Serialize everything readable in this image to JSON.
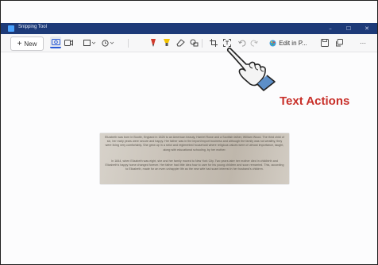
{
  "window": {
    "title": "Snipping Tool",
    "minimize": "–",
    "maximize": "☐",
    "close": "✕"
  },
  "toolbar": {
    "new_label": "New",
    "new_plus": "+",
    "edit_label": "Edit in P...",
    "more_label": "···"
  },
  "callout": {
    "label": "Text Actions"
  },
  "captured_text": {
    "paragraph_1": "Elizabeth was born in Bootle, England in 1826 to an American beauty, Harriet Rowe and a Scottish father, William Wood. The third child of six, her early years were secure and happy. Her father was in the import/export business and although the family was not wealthy, they were living very comfortably. She grew up in a strict and regimented household where religious values were of utmost importance, taught, along with educational schooling, by her mother.",
    "paragraph_2": "In 1844, when Elizabeth was eight, she and her family moved to New York City. Two years later her mother died in childbirth and Elizabeth's happy home changed forever. Her father had little idea how to care for his young children and soon remarried. This, according to Elizabeth, made for an even unhappier life as the new wife had scant interest in her husband's children."
  },
  "colors": {
    "titlebar": "#1d3a78",
    "accent": "#2a5bd7",
    "callout": "#c8302a"
  },
  "icons": [
    "snipping-tool-icon",
    "camera-icon",
    "video-icon",
    "rectangle-snip-icon",
    "timer-icon",
    "ballpoint-pen-icon",
    "highlighter-icon",
    "eraser-icon",
    "shapes-icon",
    "crop-icon",
    "text-actions-icon",
    "undo-icon",
    "redo-icon",
    "paint-icon",
    "save-icon",
    "copy-icon",
    "pointing-hand-icon"
  ]
}
